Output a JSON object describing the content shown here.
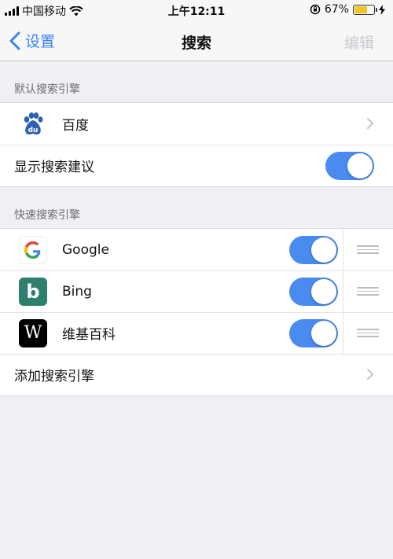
{
  "status": {
    "carrier": "中国移动",
    "time": "上午12:11",
    "battery_percent": "67%",
    "battery_level": 0.67,
    "icons": [
      "signal-icon",
      "wifi-icon",
      "orientation-lock-icon",
      "battery-icon",
      "charging-icon"
    ]
  },
  "nav": {
    "back_label": "设置",
    "title": "搜索",
    "edit_label": "编辑"
  },
  "default_engine": {
    "header": "默认搜索引擎",
    "engine_name": "百度",
    "engine_icon_text": "du",
    "suggest_label": "显示搜索建议",
    "suggest_on": true
  },
  "quick_search": {
    "header": "快速搜索引擎",
    "engines": [
      {
        "name": "Google",
        "icon": "google-icon",
        "enabled": true
      },
      {
        "name": "Bing",
        "icon": "bing-icon",
        "icon_text": "b",
        "enabled": true
      },
      {
        "name": "维基百科",
        "icon": "wikipedia-icon",
        "icon_text": "W",
        "enabled": true
      }
    ],
    "add_label": "添加搜索引擎"
  },
  "colors": {
    "accent": "#3b82f6",
    "toggle_on": "#4a8bf0",
    "bing": "#2f7f6e",
    "baidu": "#2f5fb3"
  }
}
